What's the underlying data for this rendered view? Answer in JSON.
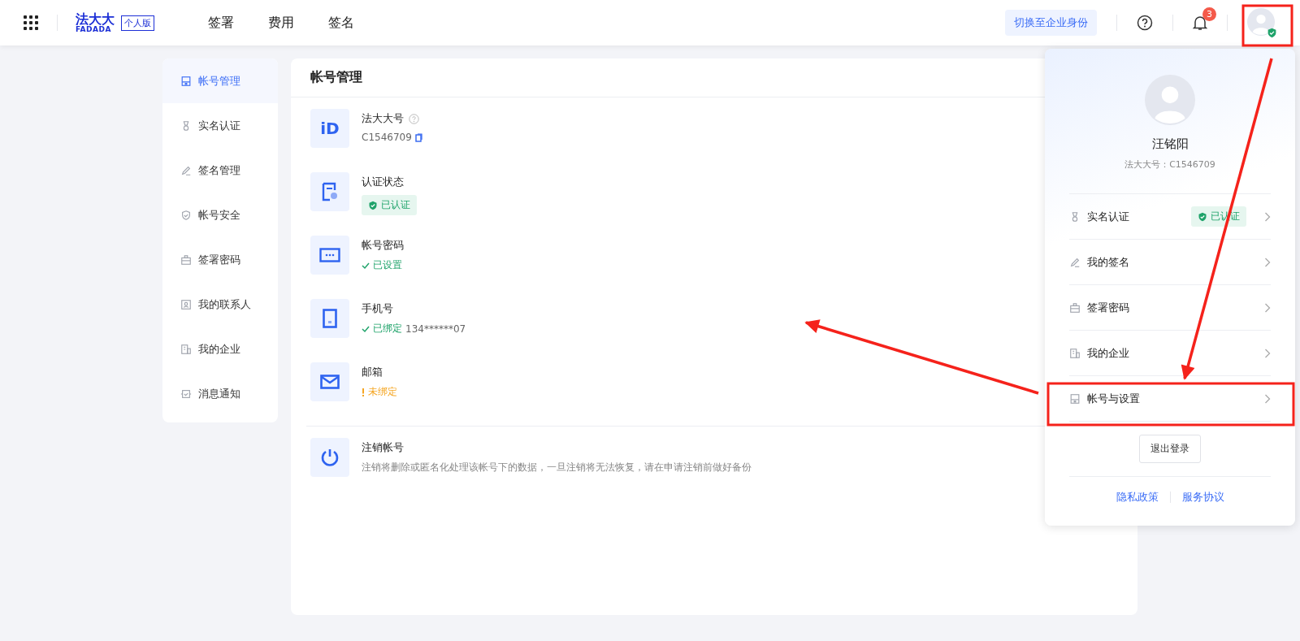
{
  "header": {
    "logo_cn": "法大大",
    "logo_en": "FADADA",
    "edition": "个人版",
    "nav": [
      "签署",
      "费用",
      "签名"
    ],
    "switch_button": "切换至企业身份",
    "notifications": "3",
    "avatar_verified": true
  },
  "sidebar": {
    "items": [
      {
        "label": "帐号管理",
        "selected": true
      },
      {
        "label": "实名认证",
        "selected": false
      },
      {
        "label": "签名管理",
        "selected": false
      },
      {
        "label": "帐号安全",
        "selected": false
      },
      {
        "label": "签署密码",
        "selected": false
      },
      {
        "label": "我的联系人",
        "selected": false
      },
      {
        "label": "我的企业",
        "selected": false
      },
      {
        "label": "消息通知",
        "selected": false
      }
    ]
  },
  "main": {
    "title": "帐号管理",
    "rows": [
      {
        "icon_text": "iD",
        "label": "法大大号",
        "kind": "id",
        "value": "C1546709"
      },
      {
        "label": "认证状态",
        "kind": "badge",
        "value": "已认证"
      },
      {
        "label": "帐号密码",
        "kind": "ok",
        "value": "已设置"
      },
      {
        "label": "手机号",
        "kind": "ok",
        "value": "已绑定",
        "extra": "134******07"
      },
      {
        "label": "邮箱",
        "kind": "warn",
        "value": "未绑定"
      },
      {
        "label": "注销帐号",
        "kind": "desc",
        "value": "注销将删除或匿名化处理该帐号下的数据，一旦注销将无法恢复，请在申请注销前做好备份",
        "divider": true
      }
    ]
  },
  "dropdown": {
    "name": "汪铭阳",
    "account": "法大大号：C1546709",
    "items": [
      {
        "label": "实名认证",
        "badge": "已认证",
        "highlighted": false
      },
      {
        "label": "我的签名",
        "highlighted": false
      },
      {
        "label": "签署密码",
        "highlighted": false
      },
      {
        "label": "我的企业",
        "highlighted": false
      },
      {
        "label": "帐号与设置",
        "highlighted": true
      }
    ],
    "logout": "退出登录",
    "links": [
      "隐私政策",
      "服务协议"
    ]
  }
}
